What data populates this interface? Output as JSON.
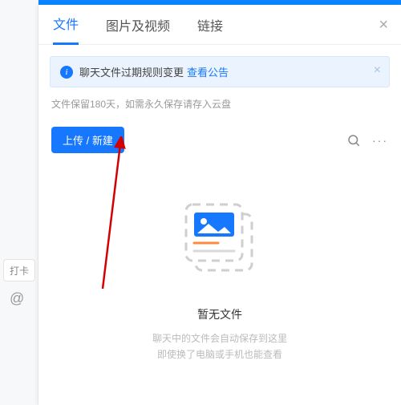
{
  "colors": {
    "accent": "#1677ff"
  },
  "left": {
    "chip": "打卡",
    "at": "@"
  },
  "tabs": {
    "items": [
      {
        "label": "文件",
        "active": true
      },
      {
        "label": "图片及视频",
        "active": false
      },
      {
        "label": "链接",
        "active": false
      }
    ]
  },
  "notice": {
    "text": "聊天文件过期规则变更",
    "link": "查看公告"
  },
  "hint": "文件保留180天，如需永久保存请存入云盘",
  "toolbar": {
    "upload_label": "上传 / 新建"
  },
  "empty": {
    "title": "暂无文件",
    "line1": "聊天中的文件会自动保存到这里",
    "line2": "即使换了电脑或手机也能查看"
  },
  "icons": {
    "info": "info-icon",
    "close": "close-icon",
    "search": "search-icon",
    "more": "more-icon",
    "image_placeholder": "image-placeholder-icon"
  }
}
